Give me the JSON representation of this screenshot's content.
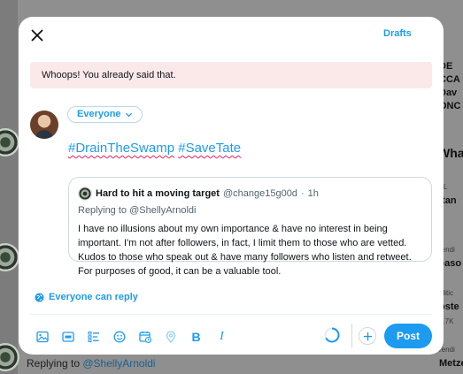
{
  "modal": {
    "drafts_label": "Drafts",
    "alert_text": "Whoops! You already said that.",
    "audience_label": "Everyone",
    "compose": {
      "hashtag_1": "#DrainTheSwamp",
      "hashtag_2": "#SaveTate"
    },
    "quote": {
      "author_name": "Hard to hit a moving target",
      "author_handle": "@change15g00d",
      "separator": "·",
      "time": "1h",
      "replying_prefix": "Replying to ",
      "replying_handle": "@ShellyArnoldi",
      "body": "I have no illusions about my own importance & have no interest in being important.  I'm not after followers, in fact, I limit them to those who are vetted.  Kudos to those who speak out & have many followers who listen and retweet. For purposes of good, it can be a valuable tool."
    },
    "reply_setting_label": "Everyone can reply",
    "post_label": "Post",
    "toolbar_icons": [
      "media-icon",
      "gif-icon",
      "poll-icon",
      "emoji-icon",
      "schedule-icon",
      "location-icon",
      "bold-icon",
      "italic-icon"
    ],
    "bold_glyph": "B",
    "italic_glyph": "I"
  },
  "background": {
    "right_lines": [
      "DE",
      "CCA",
      "Dav",
      "ONC",
      "Wha",
      "FL",
      "itan",
      "rendi",
      "easo",
      "olitic",
      "pste",
      "3.7K",
      "rendi",
      "Metze"
    ],
    "bottom_reply_prefix": "Replying to ",
    "bottom_reply_handle": "@ShellyArnoldi"
  },
  "colors": {
    "accent": "#1d9bf0",
    "alert_bg": "#fbe9ea",
    "spellcheck_underline": "#e0245e"
  }
}
